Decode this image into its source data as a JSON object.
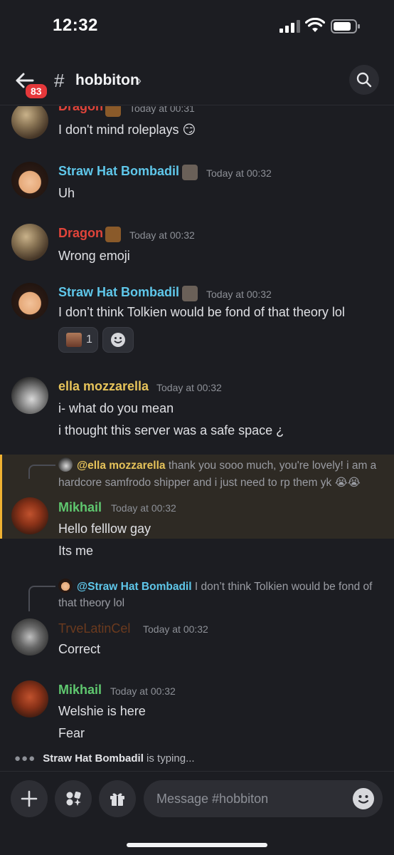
{
  "status_bar": {
    "time": "12:32"
  },
  "header": {
    "badge_count": "83",
    "hash": "#",
    "channel_name": "hobbiton",
    "chevron": "›"
  },
  "colors": {
    "dragon": "#e0443a",
    "bombadil": "#5fc7ea",
    "ella": "#e6c35a",
    "mikhail": "#5fc76f",
    "trve": "#6b3a1e",
    "accent_highlight": "#f0b232"
  },
  "messages": [
    {
      "author": "Dragon",
      "time": "Today at 00:31",
      "lines": [
        "I don't mind roleplays 😏"
      ]
    },
    {
      "author": "Straw Hat Bombadil",
      "time": "Today at 00:32",
      "lines": [
        "Uh"
      ]
    },
    {
      "author": "Dragon",
      "time": "Today at 00:32",
      "lines": [
        "Wrong emoji"
      ]
    },
    {
      "author": "Straw Hat Bombadil",
      "time": "Today at 00:32",
      "lines": [
        "I don’t think Tolkien would be fond of that theory lol"
      ],
      "reaction_count": "1"
    },
    {
      "author": "ella mozzarella",
      "time": "Today at 00:32",
      "lines": [
        "i- what do you mean",
        "i thought this server was a safe space ¿"
      ]
    },
    {
      "author": "Mikhail",
      "time": "Today at 00:32",
      "reply": {
        "mention": "@ella mozzarella",
        "text_1": "thank you sooo much, you're lovely! i am a",
        "text_2": "hardcore samfrodo shipper and i just need to rp them yk 😭😭"
      },
      "lines": [
        "Hello felllow gay",
        "Its me"
      ]
    },
    {
      "author": "TrveLatinCel",
      "time": "Today at 00:32",
      "reply": {
        "mention": "@Straw Hat Bombadil",
        "text_1": "I don’t think Tolkien would be fond of",
        "text_2": "that theory lol"
      },
      "lines": [
        "Correct"
      ]
    },
    {
      "author": "Mikhail",
      "time": "Today at 00:32",
      "lines": [
        "Welshie is here",
        "Fear"
      ]
    }
  ],
  "typing": {
    "user": "Straw Hat Bombadil",
    "suffix": "is typing..."
  },
  "composer": {
    "placeholder": "Message #hobbiton"
  }
}
